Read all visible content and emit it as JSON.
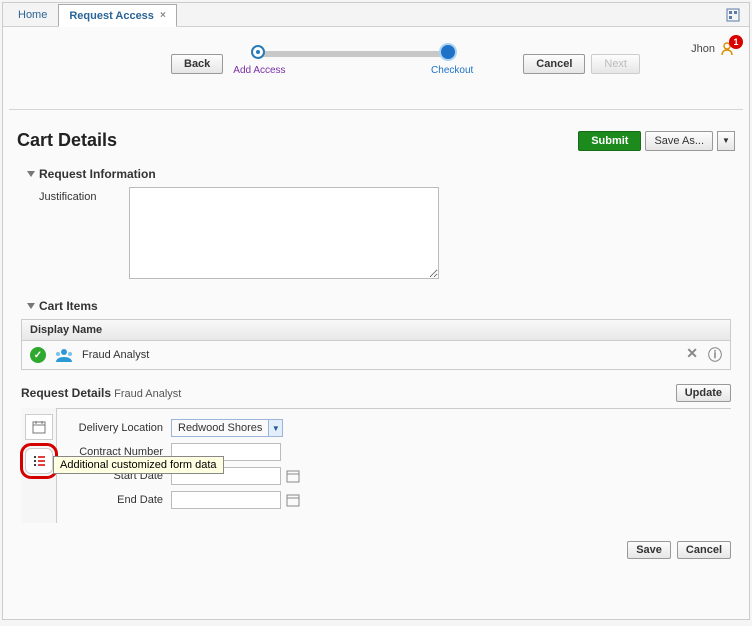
{
  "tabs": {
    "home": "Home",
    "request_access": "Request Access"
  },
  "wizard": {
    "back": "Back",
    "add_access": "Add Access",
    "checkout": "Checkout",
    "cancel": "Cancel",
    "next": "Next"
  },
  "user": {
    "name": "Jhon",
    "badge": "1"
  },
  "page": {
    "title": "Cart Details",
    "submit": "Submit",
    "save_as": "Save As..."
  },
  "sections": {
    "request_information": "Request Information",
    "cart_items": "Cart Items"
  },
  "form": {
    "justification_label": "Justification",
    "justification_value": ""
  },
  "table": {
    "col_display_name": "Display Name",
    "row0_name": "Fraud Analyst"
  },
  "request_details": {
    "label": "Request Details",
    "subject": "Fraud Analyst",
    "update": "Update"
  },
  "details": {
    "delivery_location_label": "Delivery Location",
    "delivery_location_value": "Redwood Shores",
    "contract_number_label": "Contract Number",
    "contract_number_value": "",
    "start_date_label": "Start Date",
    "start_date_value": "",
    "end_date_label": "End Date",
    "end_date_value": ""
  },
  "tooltip": "Additional customized form data",
  "footer": {
    "save": "Save",
    "cancel": "Cancel"
  }
}
